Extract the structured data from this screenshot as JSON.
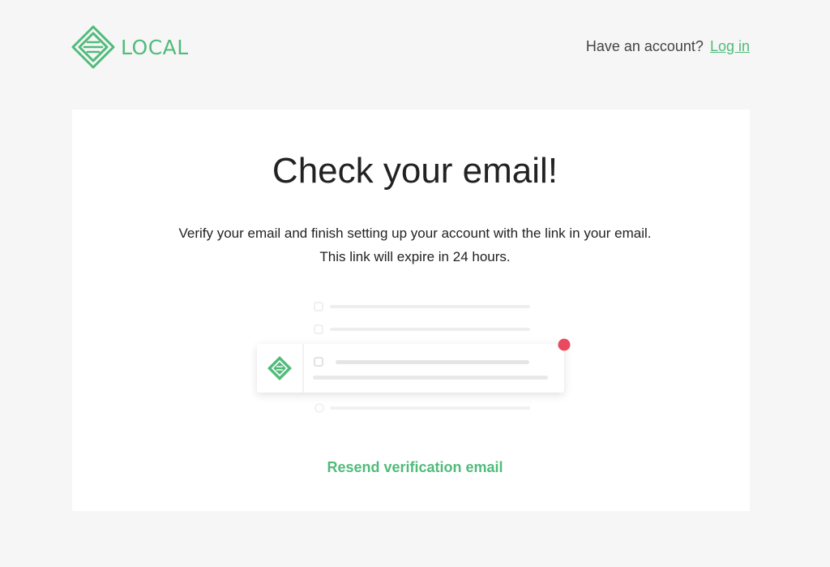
{
  "brand": {
    "name": "LOCAL",
    "color": "#51bb7b"
  },
  "header": {
    "account_prompt": "Have an account?",
    "login_label": "Log in"
  },
  "main": {
    "title": "Check your email!",
    "description_line1": "Verify your email and finish setting up your account with the link in your email.",
    "description_line2": "This link will expire in 24 hours.",
    "resend_label": "Resend verification email"
  },
  "illustration": {
    "notification_dot_color": "#e94a5f",
    "icon": "local-logo-icon"
  }
}
